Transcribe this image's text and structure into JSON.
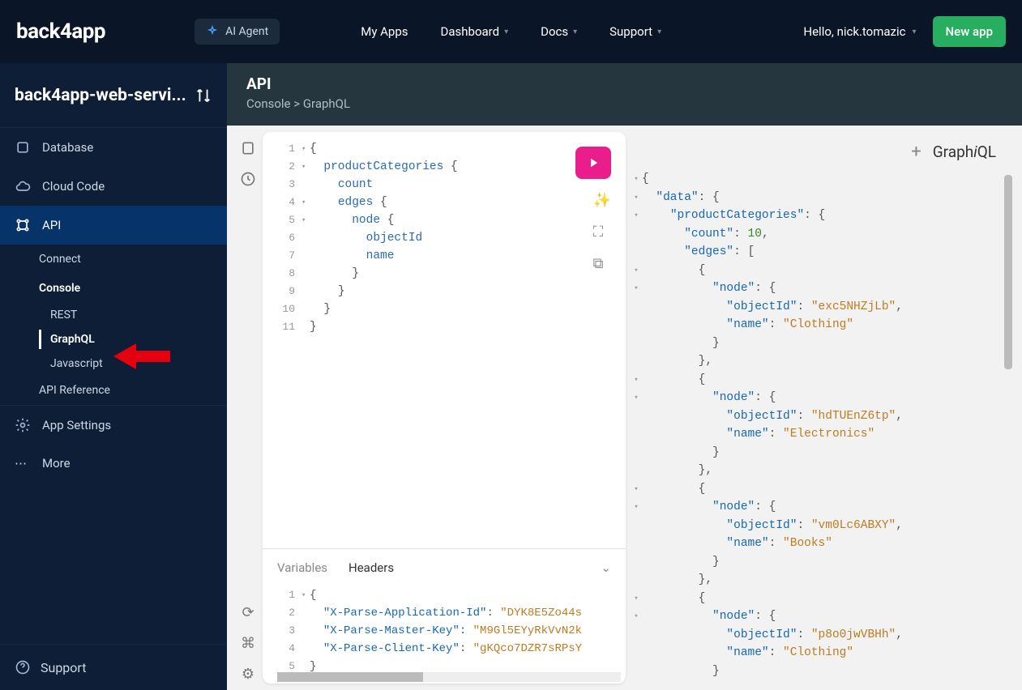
{
  "topnav": {
    "logo": "back4app",
    "ai_agent": "AI Agent",
    "links": {
      "my_apps": "My Apps",
      "dashboard": "Dashboard",
      "docs": "Docs",
      "support": "Support"
    },
    "greeting": "Hello, nick.tomazic",
    "new_app": "New app"
  },
  "sidebar": {
    "app_name": "back4app-web-servi...",
    "items": {
      "database": "Database",
      "cloud_code": "Cloud Code",
      "api": "API",
      "connect": "Connect",
      "console": "Console",
      "rest": "REST",
      "graphql": "GraphQL",
      "javascript": "Javascript",
      "api_reference": "API Reference",
      "app_settings": "App Settings",
      "more": "More",
      "support": "Support"
    }
  },
  "page": {
    "title": "API",
    "crumb1": "Console",
    "sep": ">",
    "crumb2": "GraphQL"
  },
  "editor": {
    "lines": [
      "{",
      "  productCategories {",
      "    count",
      "    edges {",
      "      node {",
      "        objectId",
      "        name",
      "      }",
      "    }",
      "  }",
      "}"
    ]
  },
  "tabs": {
    "variables": "Variables",
    "headers": "Headers"
  },
  "headers_editor": {
    "l1": "{",
    "k1": "\"X-Parse-Application-Id\"",
    "v1": "\"DYK8E5Zo44s",
    "k2": "\"X-Parse-Master-Key\"",
    "v2": "\"M9Gl5EYyRkVvN2k",
    "k3": "\"X-Parse-Client-Key\"",
    "v3": "\"gKQco7DZR7sRPsY",
    "l5": "}"
  },
  "result_header": {
    "title_a": "Graph",
    "title_i": "i",
    "title_b": "QL"
  },
  "result": {
    "rows": [
      {
        "i": 0,
        "t": "{"
      },
      {
        "i": 1,
        "k": "\"data\"",
        "t": ": {"
      },
      {
        "i": 2,
        "k": "\"productCategories\"",
        "t": ": {"
      },
      {
        "i": 3,
        "k": "\"count\"",
        "n": "10",
        "t": ","
      },
      {
        "i": 3,
        "k": "\"edges\"",
        "t": ": ["
      },
      {
        "i": 4,
        "t": "{"
      },
      {
        "i": 5,
        "k": "\"node\"",
        "t": ": {"
      },
      {
        "i": 6,
        "k": "\"objectId\"",
        "s": "\"exc5NHZjLb\"",
        "t": ","
      },
      {
        "i": 6,
        "k": "\"name\"",
        "s": "\"Clothing\""
      },
      {
        "i": 5,
        "t": "}"
      },
      {
        "i": 4,
        "t": "},"
      },
      {
        "i": 4,
        "t": "{"
      },
      {
        "i": 5,
        "k": "\"node\"",
        "t": ": {"
      },
      {
        "i": 6,
        "k": "\"objectId\"",
        "s": "\"hdTUEnZ6tp\"",
        "t": ","
      },
      {
        "i": 6,
        "k": "\"name\"",
        "s": "\"Electronics\""
      },
      {
        "i": 5,
        "t": "}"
      },
      {
        "i": 4,
        "t": "},"
      },
      {
        "i": 4,
        "t": "{"
      },
      {
        "i": 5,
        "k": "\"node\"",
        "t": ": {"
      },
      {
        "i": 6,
        "k": "\"objectId\"",
        "s": "\"vm0Lc6ABXY\"",
        "t": ","
      },
      {
        "i": 6,
        "k": "\"name\"",
        "s": "\"Books\""
      },
      {
        "i": 5,
        "t": "}"
      },
      {
        "i": 4,
        "t": "},"
      },
      {
        "i": 4,
        "t": "{"
      },
      {
        "i": 5,
        "k": "\"node\"",
        "t": ": {"
      },
      {
        "i": 6,
        "k": "\"objectId\"",
        "s": "\"p8o0jwVBHh\"",
        "t": ","
      },
      {
        "i": 6,
        "k": "\"name\"",
        "s": "\"Clothing\""
      },
      {
        "i": 5,
        "t": "}"
      }
    ]
  }
}
